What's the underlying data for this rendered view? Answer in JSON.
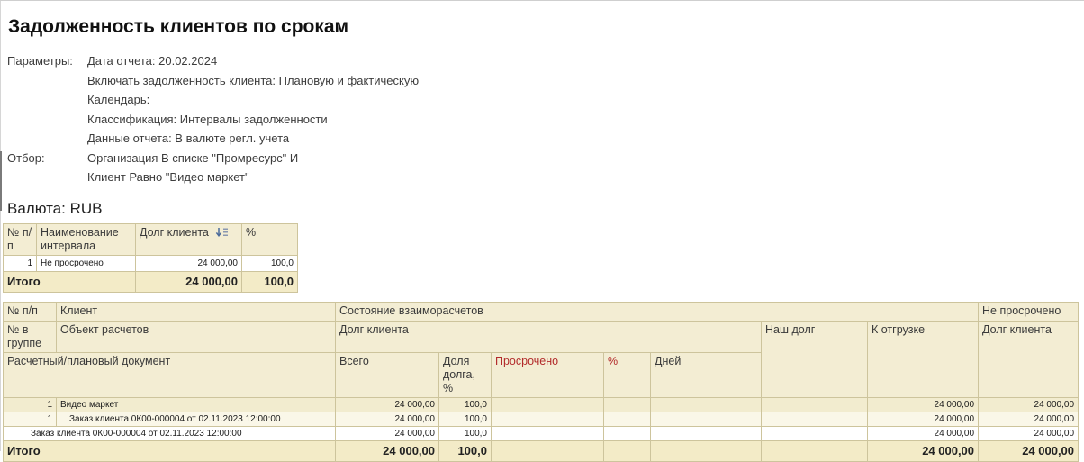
{
  "report": {
    "title": "Задолженность клиентов по срокам",
    "params_label": "Параметры:",
    "params": [
      "Дата отчета: 20.02.2024",
      "Включать задолженность клиента: Плановую и фактическую",
      "Календарь:",
      "Классификация: Интервалы задолженности",
      "Данные отчета: В валюте регл. учета"
    ],
    "filter_label": "Отбор:",
    "filters": [
      "Организация В списке \"Промресурс\" И",
      "Клиент Равно \"Видео маркет\""
    ],
    "currency_heading": "Валюта: RUB"
  },
  "colors": {
    "header_bg": "#f3edd3",
    "group_row_bg": "#f2eccf",
    "subgroup_row_bg": "#faf7e8",
    "total_row_bg": "#f3ebc7",
    "grid_border": "#cdc49c",
    "overdue_red": "#b22a2a"
  },
  "summary_table": {
    "col_num": "№ п/п",
    "col_interval": "Наименование интервала",
    "col_debt": "Долг клиента",
    "col_pct": "%",
    "sort_icon": "sort-descending-icon",
    "row": {
      "num": "1",
      "interval": "Не просрочено",
      "debt": "24 000,00",
      "pct": "100,0"
    },
    "total_label": "Итого",
    "total_debt": "24 000,00",
    "total_pct": "100,0"
  },
  "detail_table": {
    "h_num": "№ п/п",
    "h_client": "Клиент",
    "h_state": "Состояние взаиморасчетов",
    "h_not_overdue": "Не просрочено",
    "h_num_group": "№ в группе",
    "h_object": "Объект расчетов",
    "h_client_debt": "Долг клиента",
    "h_our_debt": "Наш долг",
    "h_to_ship": "К отгрузке",
    "h_client_debt2": "Долг клиента",
    "h_doc": "Расчетный/плановый документ",
    "h_total": "Всего",
    "h_share": "Доля долга, %",
    "h_overdue": "Просрочено",
    "h_pct": "%",
    "h_days": "Дней",
    "rows": [
      {
        "num": "1",
        "name": "Видео маркет",
        "total": "24 000,00",
        "share": "100,0",
        "overdue": "",
        "pct": "",
        "days": "",
        "our_debt": "",
        "to_ship": "24 000,00",
        "not_overdue": "24 000,00"
      },
      {
        "num": "1",
        "name": "Заказ клиента 0К00-000004 от 02.11.2023 12:00:00",
        "total": "24 000,00",
        "share": "100,0",
        "overdue": "",
        "pct": "",
        "days": "",
        "our_debt": "",
        "to_ship": "24 000,00",
        "not_overdue": "24 000,00"
      },
      {
        "num": "",
        "name": "Заказ клиента 0К00-000004 от 02.11.2023 12:00:00",
        "total": "24 000,00",
        "share": "100,0",
        "overdue": "",
        "pct": "",
        "days": "",
        "our_debt": "",
        "to_ship": "24 000,00",
        "not_overdue": "24 000,00"
      }
    ],
    "total": {
      "label": "Итого",
      "total": "24 000,00",
      "share": "100,0",
      "overdue": "",
      "pct": "",
      "days": "",
      "our_debt": "",
      "to_ship": "24 000,00",
      "not_overdue": "24 000,00"
    }
  }
}
